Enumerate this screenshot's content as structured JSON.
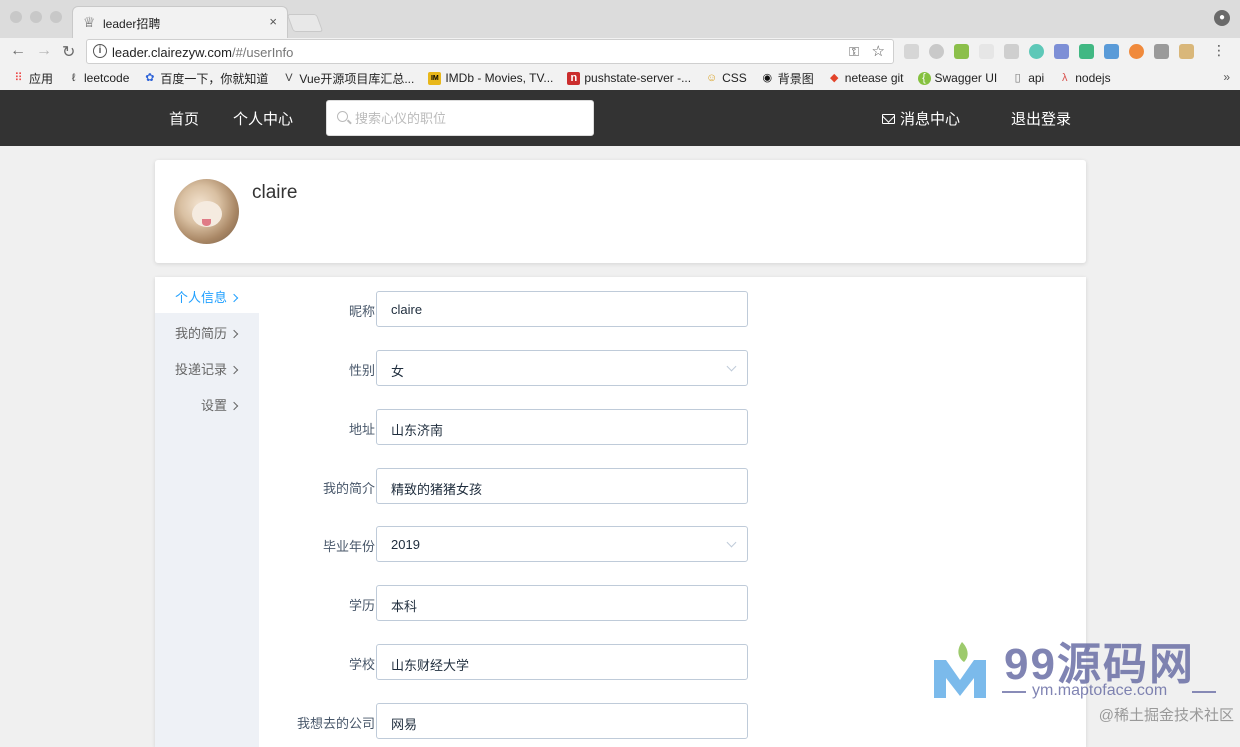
{
  "browser": {
    "tab_title": "leader招聘",
    "tab_close": "×",
    "url_host": "leader.clairezyw.com",
    "url_path": "/#/userInfo",
    "bookmarks": [
      {
        "label": "应用",
        "icon": "apps-grid-icon"
      },
      {
        "label": "leetcode",
        "icon": "leetcode-icon"
      },
      {
        "label": "百度一下，你就知道",
        "icon": "baidu-paw-icon"
      },
      {
        "label": "Vue开源项目库汇总...",
        "icon": "vue-icon"
      },
      {
        "label": "IMDb - Movies, TV...",
        "icon": "imdb-icon"
      },
      {
        "label": "pushstate-server -...",
        "icon": "npm-icon"
      },
      {
        "label": "CSS",
        "icon": "css-icon"
      },
      {
        "label": "背景图",
        "icon": "camera-icon"
      },
      {
        "label": "netease git",
        "icon": "gitlab-icon"
      },
      {
        "label": "Swagger UI",
        "icon": "swagger-icon"
      },
      {
        "label": "api",
        "icon": "document-icon"
      },
      {
        "label": "nodejs",
        "icon": "nodejs-icon"
      }
    ],
    "bookmarks_more": "»"
  },
  "header": {
    "home": "首页",
    "personal_center": "个人中心",
    "search_placeholder": "搜索心仪的职位",
    "messages": "消息中心",
    "logout": "退出登录",
    "bg_color": "#333333"
  },
  "profile": {
    "username": "claire"
  },
  "sidebar": {
    "items": [
      {
        "label": "个人信息",
        "active": true
      },
      {
        "label": "我的简历",
        "active": false
      },
      {
        "label": "投递记录",
        "active": false
      },
      {
        "label": "设置",
        "active": false
      }
    ],
    "active_color": "#20a0ff"
  },
  "form": {
    "fields": [
      {
        "label": "昵称",
        "value": "claire",
        "type": "input"
      },
      {
        "label": "性别",
        "value": "女",
        "type": "select"
      },
      {
        "label": "地址",
        "value": "山东济南",
        "type": "input"
      },
      {
        "label": "我的简介",
        "value": "精致的猪猪女孩",
        "type": "input"
      },
      {
        "label": "毕业年份",
        "value": "2019",
        "type": "select"
      },
      {
        "label": "学历",
        "value": "本科",
        "type": "input"
      },
      {
        "label": "学校",
        "value": "山东财经大学",
        "type": "input"
      },
      {
        "label": "我想去的公司",
        "value": "网易",
        "type": "input"
      }
    ]
  },
  "watermark": {
    "brand": "99源码网",
    "site": "ym.maptoface.com",
    "credit": "@稀土掘金技术社区"
  }
}
